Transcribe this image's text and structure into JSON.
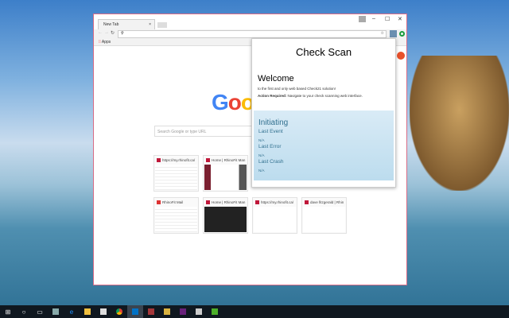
{
  "browser": {
    "tab_title": "New Tab",
    "tab_close": "×",
    "window_controls": [
      "–",
      "☐",
      "✕"
    ],
    "bookmarks_label": "Apps",
    "search_placeholder": "Search Google or type URL",
    "logo": "Google"
  },
  "tiles": [
    {
      "title": "https://my.rhinofit.ca/"
    },
    {
      "title": "Home | RhinoFit Man"
    },
    {
      "title": "RhinoFit Mail"
    },
    {
      "title": "Home | RhinoFit Man"
    },
    {
      "title": "https://my.rhinofit.ca/"
    },
    {
      "title": "dave fitzgerald | Rhin"
    }
  ],
  "popup": {
    "title": "Check Scan",
    "welcome": "Welcome",
    "subtitle": "to the first and only web based Check21 solution!",
    "action_label": "Action Required:",
    "action_text": "Navigate to your check scanning web interface.",
    "status": {
      "heading": "Initiating",
      "last_event_label": "Last Event",
      "last_event": "N/A",
      "last_error_label": "Last Error",
      "last_error": "N/A",
      "last_crash_label": "Last Crash",
      "last_crash": "N/A"
    }
  },
  "taskbar": {
    "items": [
      "start",
      "cortana",
      "task-view",
      "network",
      "edge",
      "file-explorer",
      "store",
      "chrome",
      "outlook",
      "access",
      "tools",
      "visual-studio",
      "calculator",
      "dreamweaver"
    ]
  }
}
